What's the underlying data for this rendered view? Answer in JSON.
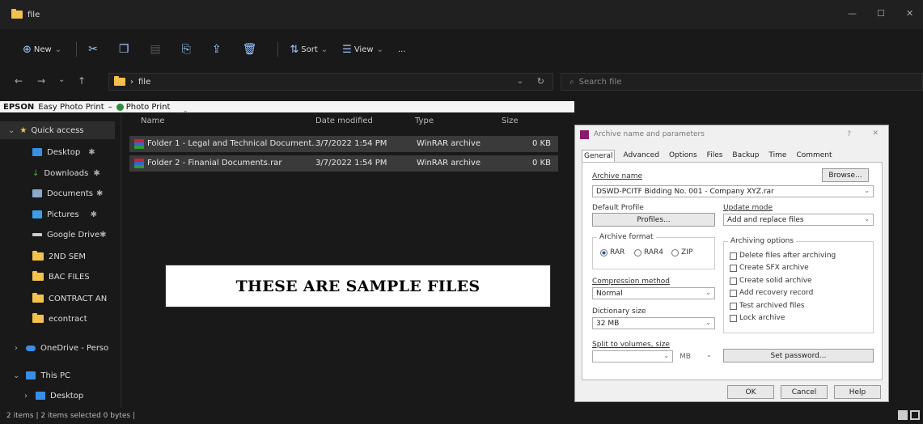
{
  "window": {
    "title": "file"
  },
  "toolbar": {
    "new_label": "New",
    "sort_label": "Sort",
    "view_label": "View",
    "more_label": "..."
  },
  "address": {
    "crumb": "file",
    "search_placeholder": "Search file"
  },
  "epson": {
    "brand": "EPSON",
    "app": "Easy Photo Print",
    "sep": "–",
    "photo_print": "Photo Print"
  },
  "sidebar": {
    "items": [
      {
        "label": "Quick access"
      },
      {
        "label": "Desktop"
      },
      {
        "label": "Downloads"
      },
      {
        "label": "Documents"
      },
      {
        "label": "Pictures"
      },
      {
        "label": "Google Drive"
      },
      {
        "label": "2ND SEM"
      },
      {
        "label": "BAC FILES"
      },
      {
        "label": "CONTRACT AN"
      },
      {
        "label": "econtract"
      },
      {
        "label": "OneDrive - Perso"
      },
      {
        "label": "This PC"
      },
      {
        "label": "Desktop"
      }
    ]
  },
  "files": {
    "headers": [
      "Name",
      "Date modified",
      "Type",
      "Size"
    ],
    "rows": [
      {
        "name": "Folder 1 - Legal and Technical Document...",
        "date": "3/7/2022 1:54 PM",
        "type": "WinRAR archive",
        "size": "0 KB"
      },
      {
        "name": "Folder 2 - Finanial Documents.rar",
        "date": "3/7/2022 1:54 PM",
        "type": "WinRAR archive",
        "size": "0 KB"
      }
    ]
  },
  "overlay": {
    "text": "THESE ARE SAMPLE FILES"
  },
  "status": {
    "text": "2 items  |  2 items selected  0 bytes  |"
  },
  "dialog": {
    "title": "Archive name and parameters",
    "help": "?",
    "tabs": [
      "General",
      "Advanced",
      "Options",
      "Files",
      "Backup",
      "Time",
      "Comment"
    ],
    "archive_name_label": "Archive name",
    "browse": "Browse...",
    "archive_name_value": "DSWD-PCITF Bidding No. 001 - Company XYZ.rar",
    "default_profile_label": "Default Profile",
    "profiles_button": "Profiles...",
    "update_mode_label": "Update mode",
    "update_mode_value": "Add and replace files",
    "archive_format_label": "Archive format",
    "formats": [
      "RAR",
      "RAR4",
      "ZIP"
    ],
    "archiving_options_label": "Archiving options",
    "options": [
      "Delete files after archiving",
      "Create SFX archive",
      "Create solid archive",
      "Add recovery record",
      "Test archived files",
      "Lock archive"
    ],
    "compression_label": "Compression method",
    "compression_value": "Normal",
    "dictionary_label": "Dictionary size",
    "dictionary_value": "32 MB",
    "split_label": "Split to volumes, size",
    "split_unit": "MB",
    "set_password": "Set password...",
    "ok": "OK",
    "cancel": "Cancel",
    "helpbtn": "Help"
  }
}
